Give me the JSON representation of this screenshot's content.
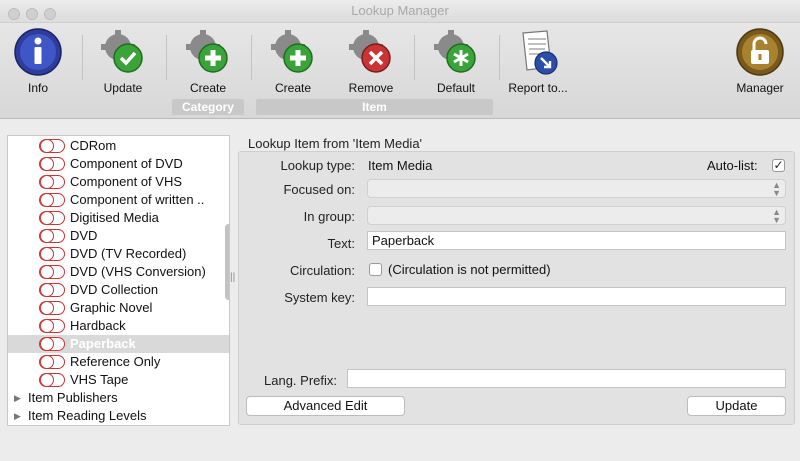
{
  "window": {
    "title": "Lookup Manager"
  },
  "toolbar": {
    "info": "Info",
    "update": "Update",
    "create_category": "Create",
    "create_item": "Create",
    "remove": "Remove",
    "default": "Default",
    "report": "Report to...",
    "manager": "Manager",
    "group_category": "Category",
    "group_item": "Item"
  },
  "sidebar": {
    "items": [
      {
        "label": "CDRom"
      },
      {
        "label": "Component of DVD"
      },
      {
        "label": "Component of VHS"
      },
      {
        "label": "Component of written .."
      },
      {
        "label": "Digitised Media"
      },
      {
        "label": "DVD"
      },
      {
        "label": "DVD (TV Recorded)"
      },
      {
        "label": "DVD (VHS Conversion)"
      },
      {
        "label": "DVD Collection"
      },
      {
        "label": "Graphic Novel"
      },
      {
        "label": "Hardback"
      },
      {
        "label": "Paperback"
      },
      {
        "label": "Reference Only"
      },
      {
        "label": "VHS Tape"
      }
    ],
    "selected": "Paperback",
    "groups": [
      {
        "label": "Item Publishers"
      },
      {
        "label": "Item Reading Levels"
      }
    ]
  },
  "detail": {
    "title": "Lookup Item from 'Item Media'",
    "lookup_type_label": "Lookup type:",
    "lookup_type_value": "Item Media",
    "autolist_label": "Auto-list:",
    "autolist_check": "✓",
    "focused_on_label": "Focused on:",
    "in_group_label": "In group:",
    "text_label": "Text:",
    "text_value": "Paperback",
    "circulation_label": "Circulation:",
    "circulation_note": "(Circulation is not permitted)",
    "system_key_label": "System key:",
    "lang_prefix_label": "Lang. Prefix:",
    "advanced_edit": "Advanced Edit",
    "update": "Update"
  }
}
